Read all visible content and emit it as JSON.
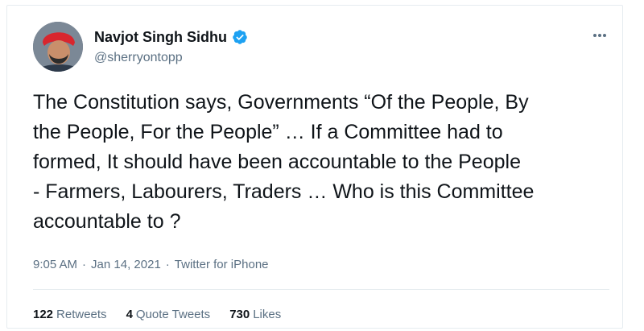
{
  "author": {
    "name": "Navjot Singh Sidhu",
    "handle": "@sherryontopp",
    "verified": true
  },
  "tweet": {
    "text": "The Constitution says, Governments “Of the People, By\nthe People, For the People” … If a Committee had to\nformed, It should have been accountable to the People\n- Farmers, Labourers, Traders … Who is this Committee\naccountable to ?",
    "time": "9:05 AM",
    "date": "Jan 14, 2021",
    "source": "Twitter for iPhone",
    "separator": "·"
  },
  "stats": {
    "retweets_count": "122",
    "retweets_label": "Retweets",
    "quotes_count": "4",
    "quotes_label": "Quote Tweets",
    "likes_count": "730",
    "likes_label": "Likes"
  },
  "colors": {
    "verified_blue": "#1da1f2",
    "secondary_text": "#5b7083",
    "divider": "#e6ecf0"
  },
  "icons": {
    "verified": "verified-badge-icon",
    "more": "more-options-icon"
  }
}
